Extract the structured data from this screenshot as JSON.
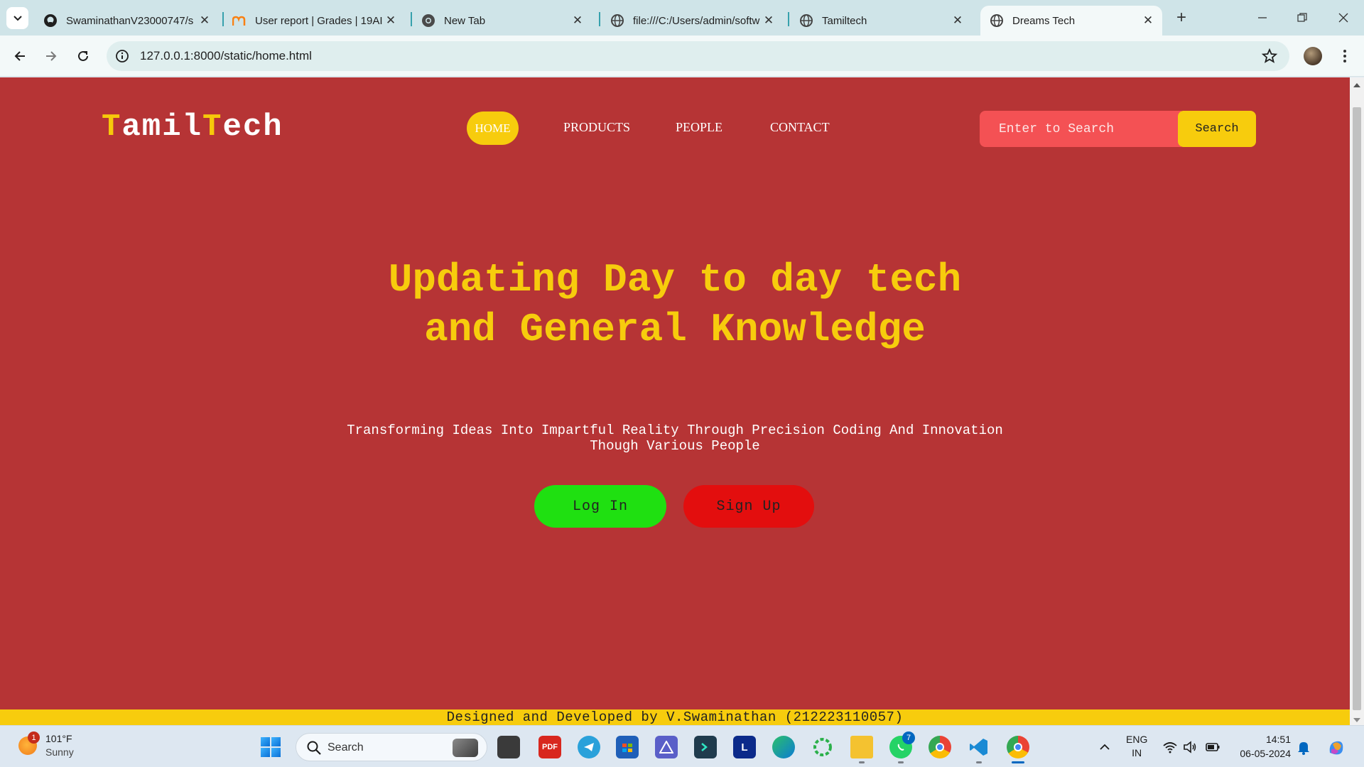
{
  "browser": {
    "tabs": [
      {
        "title": "SwaminathanV23000747/s",
        "icon": "github-icon"
      },
      {
        "title": "User report | Grades | 19AI",
        "icon": "moodle-icon"
      },
      {
        "title": "New Tab",
        "icon": "chrome-icon"
      },
      {
        "title": "file:///C:/Users/admin/softw",
        "icon": "globe-icon"
      },
      {
        "title": "Tamiltech",
        "icon": "globe-icon"
      },
      {
        "title": "Dreams Tech",
        "icon": "globe-icon",
        "active": true
      }
    ],
    "url": "127.0.0.1:8000/static/home.html"
  },
  "site": {
    "logo_first_letter": "T",
    "logo_part1": "amil",
    "logo_second_letter": "T",
    "logo_part2": "ech",
    "nav": {
      "home": "HOME",
      "products": "PRODUCTS",
      "people": "PEOPLE",
      "contact": "CONTACT"
    },
    "search_placeholder": "Enter to Search",
    "search_button": "Search",
    "hero_title": "Updating Day to day tech and General Knowledge",
    "hero_subtitle": "Transforming Ideas Into Impartful Reality Through Precision Coding And Innovation Though Various People",
    "login_button": "Log In",
    "signup_button": "Sign Up",
    "footer_text": "Designed and Developed by V.Swaminathan (212223110057)"
  },
  "taskbar": {
    "weather_temp": "101°F",
    "weather_condition": "Sunny",
    "weather_badge": "1",
    "search_label": "Search",
    "whatsapp_badge": "7",
    "lang_top": "ENG",
    "lang_bottom": "IN",
    "time": "14:51",
    "date": "06-05-2024"
  },
  "colors": {
    "page_background": "#b63435",
    "accent_yellow": "#f7cc0d",
    "search_field": "#f45154",
    "login_green": "#1fe011",
    "signup_red": "#e30e0e"
  }
}
